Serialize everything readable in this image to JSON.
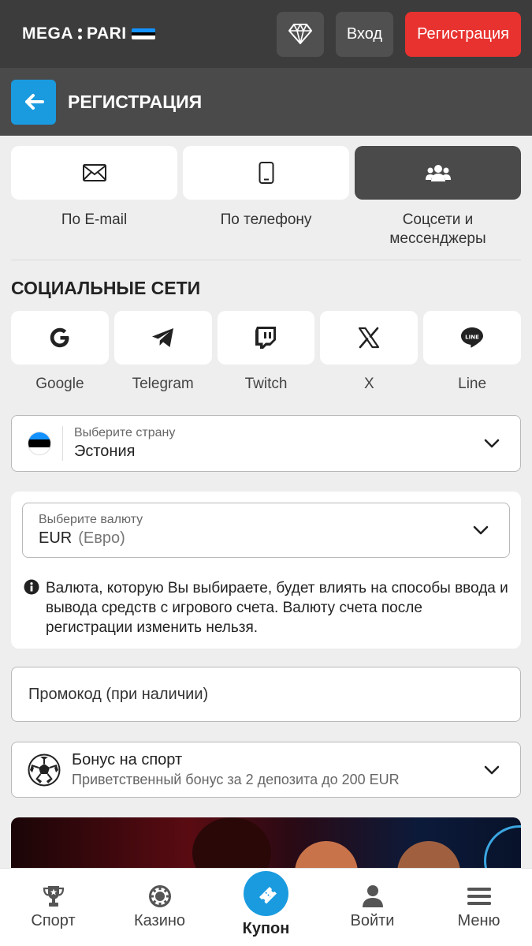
{
  "header": {
    "logo_left": "MEGA",
    "logo_right": "PARI",
    "login_label": "Вход",
    "register_label": "Регистрация",
    "colors": {
      "bg": "#3c3c3c",
      "register": "#e8322f"
    }
  },
  "title_bar": {
    "title": "РЕГИСТРАЦИЯ",
    "back_icon": "arrow-left-icon",
    "accent": "#1a9be0"
  },
  "methods": [
    {
      "label": "По E-mail",
      "icon": "envelope-icon",
      "active": false
    },
    {
      "label": "По телефону",
      "icon": "phone-icon",
      "active": false
    },
    {
      "label": "Соцсети и мессенджеры",
      "icon": "users-icon",
      "active": true
    }
  ],
  "social": {
    "title": "СОЦИАЛЬНЫЕ СЕТИ",
    "items": [
      {
        "label": "Google",
        "icon": "google-icon"
      },
      {
        "label": "Telegram",
        "icon": "telegram-icon"
      },
      {
        "label": "Twitch",
        "icon": "twitch-icon"
      },
      {
        "label": "X",
        "icon": "x-icon"
      },
      {
        "label": "Line",
        "icon": "line-icon"
      }
    ]
  },
  "country": {
    "label": "Выберите страну",
    "value": "Эстония"
  },
  "currency": {
    "label": "Выберите валюту",
    "code": "EUR",
    "name": "(Евро)",
    "notice": "Валюта, которую Вы выбираете, будет влиять на способы ввода и вывода средств с игрового счета. Валюту счета после регистрации изменить нельзя."
  },
  "promo": {
    "placeholder": "Промокод (при наличии)"
  },
  "bonus": {
    "title": "Бонус на спорт",
    "subtitle": "Приветственный бонус за 2 депозита до 200 EUR"
  },
  "bottom_nav": {
    "sport": "Спорт",
    "casino": "Казино",
    "coupon": "Купон",
    "login": "Войти",
    "menu": "Меню"
  }
}
